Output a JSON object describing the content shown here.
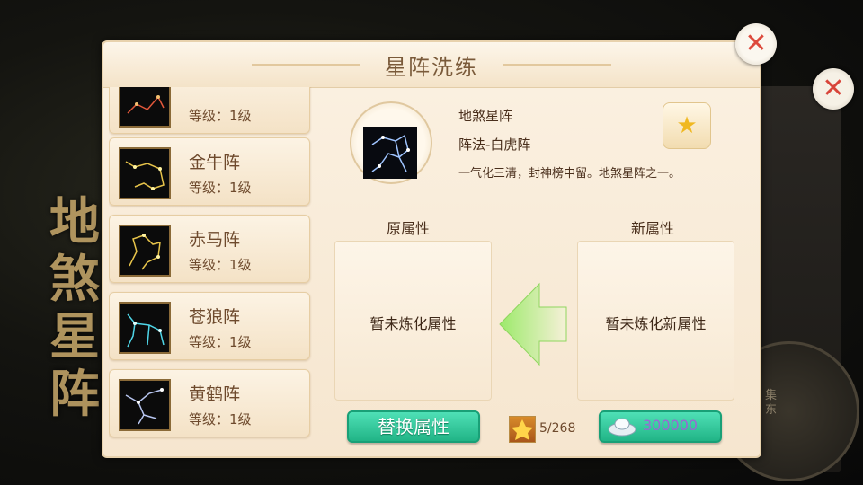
{
  "background": {
    "vertical_title": "地煞星阵",
    "side_text": "集东"
  },
  "dialog": {
    "title": "星阵洗练"
  },
  "formation_list": [
    {
      "name": "",
      "level": "等级：1级",
      "icon": "constellation-red-icon"
    },
    {
      "name": "金牛阵",
      "level": "等级：1级",
      "icon": "constellation-ox-icon"
    },
    {
      "name": "赤马阵",
      "level": "等级：1级",
      "icon": "constellation-horse-icon"
    },
    {
      "name": "苍狼阵",
      "level": "等级：1级",
      "icon": "constellation-wolf-icon"
    },
    {
      "name": "黄鹤阵",
      "level": "等级：1级",
      "icon": "constellation-crane-icon"
    }
  ],
  "selected": {
    "name": "地煞星阵",
    "formation": "阵法-白虎阵",
    "description": "一气化三清，封神榜中留。地煞星阵之一。",
    "icon": "constellation-tiger-icon"
  },
  "attributes": {
    "original_label": "原属性",
    "new_label": "新属性",
    "original_text": "暂未炼化属性",
    "new_text": "暂未炼化新属性"
  },
  "actions": {
    "replace_label": "替换属性",
    "material_count": "5/268",
    "cost_value": "300000"
  },
  "colors": {
    "accent_green": "#21b486",
    "cost_purple": "#9b66d4",
    "close_red": "#dd4a3c"
  }
}
